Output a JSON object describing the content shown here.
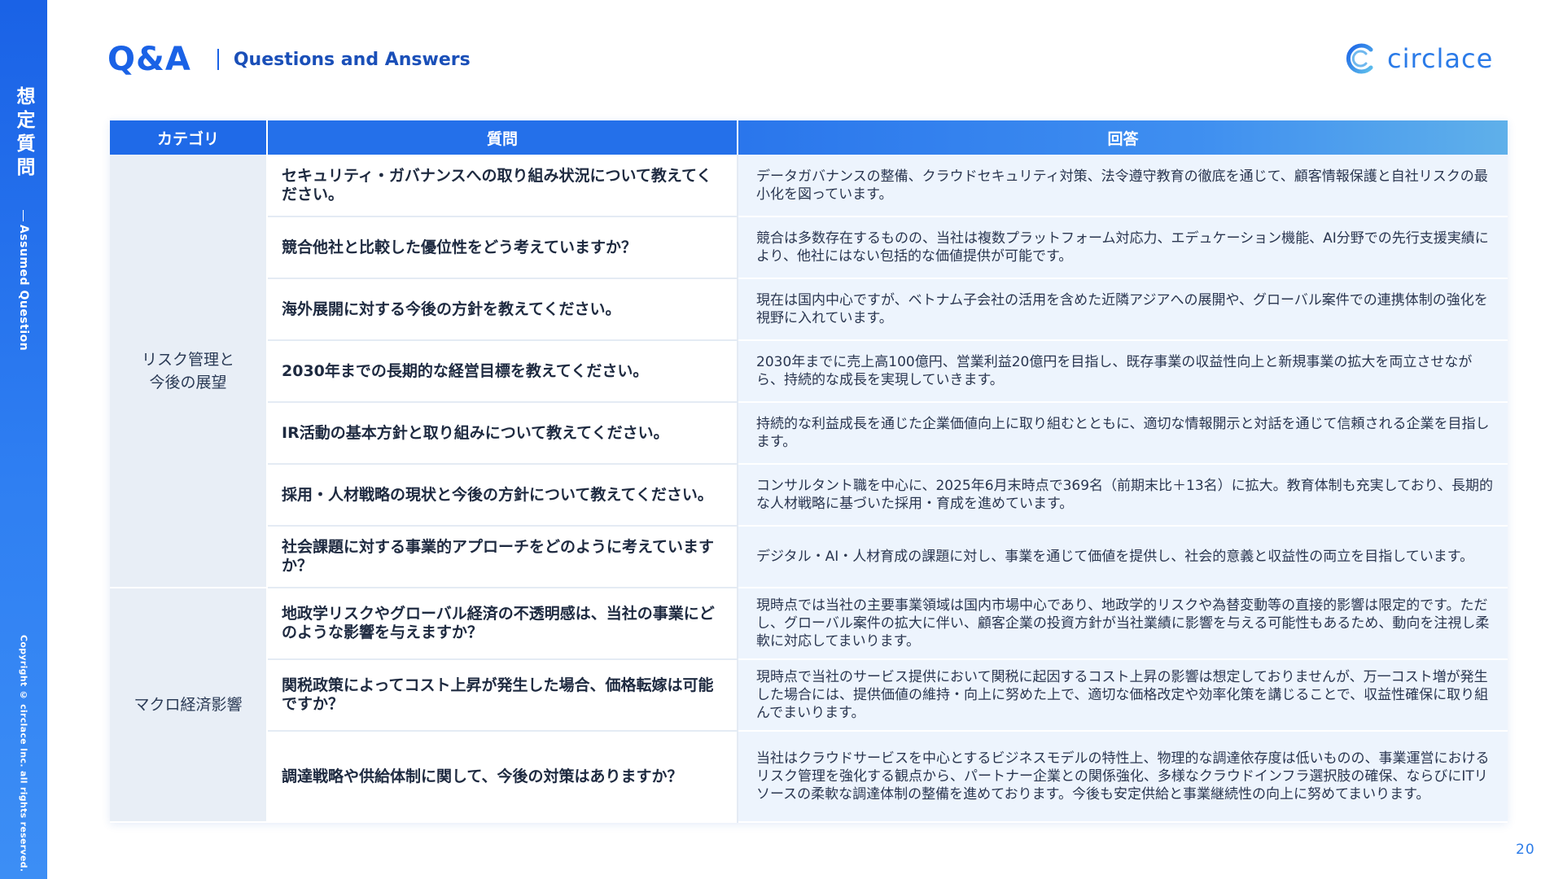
{
  "sidebar": {
    "title": "想定質問",
    "subtitle": "Assumed Question",
    "copyright": "Copyright © circlace Inc. all rights reserved."
  },
  "header": {
    "title": "Q&A",
    "subtitle": "Questions and Answers"
  },
  "logo": {
    "text": "circlace",
    "icon": "circlace-logo-icon"
  },
  "table": {
    "headers": {
      "category": "カテゴリ",
      "question": "質問",
      "answer": "回答"
    },
    "categories": [
      {
        "label_line1": "リスク管理と",
        "label_line2": "今後の展望"
      },
      {
        "label_line1": "マクロ経済影響",
        "label_line2": ""
      }
    ],
    "rows": [
      {
        "question": "セキュリティ・ガバナンスへの取り組み状況について教えてください。",
        "answer": "データガバナンスの整備、クラウドセキュリティ対策、法令遵守教育の徹底を通じて、顧客情報保護と自社リスクの最小化を図っています。"
      },
      {
        "question": "競合他社と比較した優位性をどう考えていますか？",
        "answer": "競合は多数存在するものの、当社は複数プラットフォーム対応力、エデュケーション機能、AI分野での先行支援実績により、他社にはない包括的な価値提供が可能です。"
      },
      {
        "question": "海外展開に対する今後の方針を教えてください。",
        "answer": "現在は国内中心ですが、ベトナム子会社の活用を含めた近隣アジアへの展開や、グローバル案件での連携体制の強化を視野に入れています。"
      },
      {
        "question": "2030年までの長期的な経営目標を教えてください。",
        "answer": "2030年までに売上高100億円、営業利益20億円を目指し、既存事業の収益性向上と新規事業の拡大を両立させながら、持続的な成長を実現していきます。"
      },
      {
        "question": "IR活動の基本方針と取り組みについて教えてください。",
        "answer": "持続的な利益成長を通じた企業価値向上に取り組むとともに、適切な情報開示と対話を通じて信頼される企業を目指します。"
      },
      {
        "question": "採用・人材戦略の現状と今後の方針について教えてください。",
        "answer": "コンサルタント職を中心に、2025年6月末時点で369名（前期末比＋13名）に拡大。教育体制も充実しており、長期的な人材戦略に基づいた採用・育成を進めています。"
      },
      {
        "question": "社会課題に対する事業的アプローチをどのように考えていますか？",
        "answer": "デジタル・AI・人材育成の課題に対し、事業を通じて価値を提供し、社会的意義と収益性の両立を目指しています。"
      },
      {
        "question": "地政学リスクやグローバル経済の不透明感は、当社の事業にどのような影響を与えますか？",
        "answer": "現時点では当社の主要事業領域は国内市場中心であり、地政学的リスクや為替変動等の直接的影響は限定的です。ただし、グローバル案件の拡大に伴い、顧客企業の投資方針が当社業績に影響を与える可能性もあるため、動向を注視し柔軟に対応してまいります。"
      },
      {
        "question": "関税政策によってコスト上昇が発生した場合、価格転嫁は可能ですか？",
        "answer": "現時点で当社のサービス提供において関税に起因するコスト上昇の影響は想定しておりませんが、万一コスト増が発生した場合には、提供価値の維持・向上に努めた上で、適切な価格改定や効率化策を講じることで、収益性確保に取り組んでまいります。"
      },
      {
        "question": "調達戦略や供給体制に関して、今後の対策はありますか？",
        "answer": "当社はクラウドサービスを中心とするビジネスモデルの特性上、物理的な調達依存度は低いものの、事業運営におけるリスク管理を強化する観点から、パートナー企業との関係強化、多様なクラウドインフラ選択肢の確保、ならびにITリソースの柔軟な調達体制の整備を進めております。今後も安定供給と事業継続性の向上に努めてまいります。"
      }
    ]
  },
  "page_number": "20",
  "colors": {
    "brand_blue": "#1a62e6",
    "category_bg": "#e8eef6",
    "answer_bg": "#edf4fd"
  }
}
